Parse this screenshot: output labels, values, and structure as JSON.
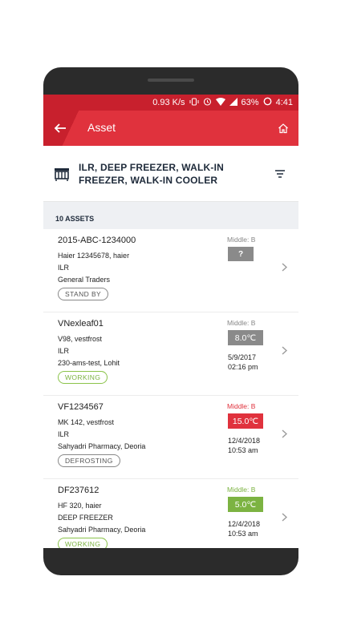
{
  "status_bar": {
    "speed": "0.93 K/s",
    "battery": "63%",
    "time": "4:41"
  },
  "app_bar": {
    "title": "Asset"
  },
  "filter": {
    "text": "ILR, DEEP FREEZER, WALK-IN FREEZER, WALK-IN COOLER"
  },
  "list": {
    "count_label": "10 ASSETS",
    "items": [
      {
        "id": "2015-ABC-1234000",
        "model": "Haier 12345678, haier",
        "type": "ILR",
        "location": "General Traders",
        "status": "STAND BY",
        "sensor": "Middle: B",
        "temperature": "?",
        "date": "",
        "time": ""
      },
      {
        "id": "VNexleaf01",
        "model": "V98, vestfrost",
        "type": "ILR",
        "location": "230-ams-test, Lohit",
        "status": "WORKING",
        "sensor": "Middle: B",
        "temperature": "8.0℃",
        "date": "5/9/2017",
        "time": "02:16 pm"
      },
      {
        "id": "VF1234567",
        "model": "MK 142, vestfrost",
        "type": "ILR",
        "location": "Sahyadri Pharmacy, Deoria",
        "status": "DEFROSTING",
        "sensor": "Middle: B",
        "temperature": "15.0℃",
        "date": "12/4/2018",
        "time": "10:53 am"
      },
      {
        "id": "DF237612",
        "model": "HF 320, haier",
        "type": "DEEP FREEZER",
        "location": "Sahyadri Pharmacy, Deoria",
        "status": "WORKING",
        "sensor": "Middle: B",
        "temperature": "5.0℃",
        "date": "12/4/2018",
        "time": "10:53 am"
      }
    ]
  },
  "colors": {
    "brand_red": "#e0323d",
    "status_bar_red": "#c8202d",
    "temp_unknown": "#8a8a8a",
    "temp_normal": "#8a8a8a",
    "temp_alarm": "#e0323d",
    "temp_ok": "#7cb342",
    "working_green": "#7cb342"
  },
  "icons": {
    "back": "arrow-left-icon",
    "home": "home-icon",
    "asset_type": "freezer-icon",
    "sort": "sort-icon",
    "chevron": "chevron-right-icon"
  }
}
